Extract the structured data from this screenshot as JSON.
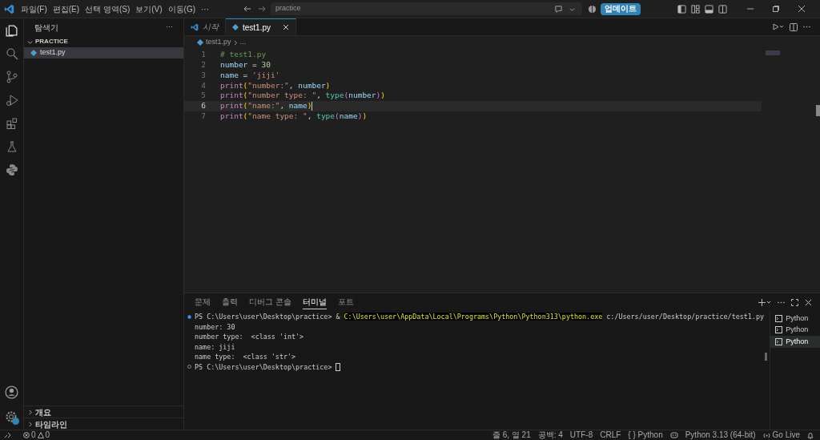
{
  "menu": [
    "파일(F)",
    "편집(E)",
    "선택 영역(S)",
    "보기(V)",
    "이동(G)",
    "···"
  ],
  "search": {
    "value": "practice"
  },
  "update_button": "업데이트",
  "sidebar": {
    "title": "탐색기",
    "more": "···",
    "folder": {
      "label": "PRACTICE",
      "expanded": true,
      "children": [
        {
          "label": "test1.py",
          "selected": true
        }
      ]
    },
    "sections": [
      {
        "label": "개요",
        "expanded": false
      },
      {
        "label": "타임라인",
        "expanded": false
      }
    ]
  },
  "tabs": [
    {
      "label": "시작",
      "kind": "welcome",
      "selected": false
    },
    {
      "label": "test1.py",
      "kind": "python",
      "selected": true
    }
  ],
  "breadcrumb": {
    "file": "test1.py",
    "rest": "..."
  },
  "code": [
    {
      "number": "1",
      "current": false,
      "tokens": [
        {
          "text": "# test1.py",
          "kind": "comment"
        }
      ]
    },
    {
      "number": "2",
      "current": false,
      "tokens": [
        {
          "text": "number",
          "kind": "name"
        },
        {
          "text": " = ",
          "kind": "op"
        },
        {
          "text": "30",
          "kind": "number"
        }
      ]
    },
    {
      "number": "3",
      "current": false,
      "tokens": [
        {
          "text": "name",
          "kind": "name"
        },
        {
          "text": " = ",
          "kind": "op"
        },
        {
          "text": "'jiji'",
          "kind": "string"
        }
      ]
    },
    {
      "number": "4",
      "current": false,
      "tokens": [
        {
          "text": "print",
          "kind": "func"
        },
        {
          "text": "(",
          "kind": "bracket1"
        },
        {
          "text": "\"number:\"",
          "kind": "string"
        },
        {
          "text": ", ",
          "kind": "op"
        },
        {
          "text": "number",
          "kind": "name"
        },
        {
          "text": ")",
          "kind": "bracket1"
        }
      ]
    },
    {
      "number": "5",
      "current": false,
      "tokens": [
        {
          "text": "print",
          "kind": "func"
        },
        {
          "text": "(",
          "kind": "bracket1"
        },
        {
          "text": "\"number type: \"",
          "kind": "string"
        },
        {
          "text": ", ",
          "kind": "op"
        },
        {
          "text": "type",
          "kind": "builtin"
        },
        {
          "text": "(",
          "kind": "bracket2"
        },
        {
          "text": "number",
          "kind": "name"
        },
        {
          "text": ")",
          "kind": "bracket2"
        },
        {
          "text": ")",
          "kind": "bracket1"
        }
      ]
    },
    {
      "number": "6",
      "current": true,
      "tokens": [
        {
          "text": "print",
          "kind": "func"
        },
        {
          "text": "(",
          "kind": "bracket1"
        },
        {
          "text": "\"name:\"",
          "kind": "string"
        },
        {
          "text": ", ",
          "kind": "op"
        },
        {
          "text": "name",
          "kind": "name"
        },
        {
          "text": ")",
          "kind": "bracket1"
        }
      ]
    },
    {
      "number": "7",
      "current": false,
      "tokens": [
        {
          "text": "print",
          "kind": "func"
        },
        {
          "text": "(",
          "kind": "bracket1"
        },
        {
          "text": "\"name type: \"",
          "kind": "string"
        },
        {
          "text": ", ",
          "kind": "op"
        },
        {
          "text": "type",
          "kind": "builtin"
        },
        {
          "text": "(",
          "kind": "bracket2"
        },
        {
          "text": "name",
          "kind": "name"
        },
        {
          "text": ")",
          "kind": "bracket2"
        },
        {
          "text": ")",
          "kind": "bracket1"
        }
      ]
    }
  ],
  "panel_tabs": [
    {
      "label": "문제",
      "selected": false
    },
    {
      "label": "출력",
      "selected": false
    },
    {
      "label": "디버그 콘솔",
      "selected": false
    },
    {
      "label": "터미널",
      "selected": true
    },
    {
      "label": "포트",
      "selected": false
    }
  ],
  "terminal": [
    {
      "kind": "success",
      "segments": [
        {
          "text": "PS C:\\Users\\user\\Desktop\\practice> ",
          "kind": "plain"
        },
        {
          "text": "& ",
          "kind": "plain"
        },
        {
          "text": "C:\\Users\\user\\AppData\\Local\\Programs\\Python\\Python313\\python.exe",
          "kind": "command"
        },
        {
          "text": " c:/Users/user/Desktop/practice/test1.py",
          "kind": "plain"
        }
      ]
    },
    {
      "kind": "output",
      "segments": [
        {
          "text": "number: 30",
          "kind": "plain"
        }
      ]
    },
    {
      "kind": "output",
      "segments": [
        {
          "text": "number type:  <class 'int'>",
          "kind": "plain"
        }
      ]
    },
    {
      "kind": "output",
      "segments": [
        {
          "text": "name: jiji",
          "kind": "plain"
        }
      ]
    },
    {
      "kind": "output",
      "segments": [
        {
          "text": "name type:  <class 'str'>",
          "kind": "plain"
        }
      ]
    },
    {
      "kind": "prompt",
      "segments": [
        {
          "text": "PS C:\\Users\\user\\Desktop\\practice> ",
          "kind": "plain"
        }
      ],
      "cursor": true
    }
  ],
  "terminal_list": [
    {
      "label": "Python",
      "selected": false
    },
    {
      "label": "Python",
      "selected": false
    },
    {
      "label": "Python",
      "selected": true
    }
  ],
  "status_left": {
    "errors": "0",
    "warnings": "0"
  },
  "status_right": [
    "줄 6, 열 21",
    "공백: 4",
    "UTF-8",
    "CRLF",
    "{ } Python",
    "Python 3.13 (64-bit)",
    "Go Live"
  ]
}
